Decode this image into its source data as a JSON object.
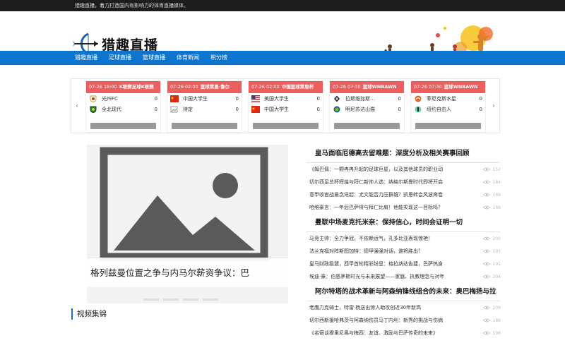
{
  "topbar": {
    "text": "猎趣直播，着力打造国内有影响力的体育直播媒体。"
  },
  "logo": {
    "text": "猎趣直播"
  },
  "nav": {
    "items": [
      "猎趣直播",
      "足球直播",
      "篮球直播",
      "体育新闻",
      "积分榜"
    ]
  },
  "matches": [
    {
      "time": "07-26 18:00",
      "league": "K联赛足球K联赛",
      "home": {
        "name": "光州FC",
        "score": "0",
        "icon": "club-crest-icon"
      },
      "away": {
        "name": "全北现代",
        "score": "0",
        "icon": "club-crest-icon"
      }
    },
    {
      "time": "07-26 02:00",
      "league": "篮球莱恩·鲁尔",
      "home": {
        "name": "中国大学生",
        "score": "0",
        "icon": "china-flag-icon"
      },
      "away": {
        "name": "待定",
        "score": "0",
        "icon": "broken-image-icon"
      }
    },
    {
      "time": "07-26 02:00",
      "league": "中国篮球莱恩杯",
      "home": {
        "name": "美国大学生",
        "score": "0",
        "icon": "usa-flag-icon"
      },
      "away": {
        "name": "中国大学生",
        "score": "0",
        "icon": "china-flag-icon"
      }
    },
    {
      "time": "07-26 07:30",
      "league": "篮球WNBAWN",
      "home": {
        "name": "拉斯维加斯…",
        "score": "0",
        "icon": "team-logo-icon"
      },
      "away": {
        "name": "明尼苏达山猫",
        "score": "0",
        "icon": "team-logo-icon"
      }
    },
    {
      "time": "07-26 07:30",
      "league": "篮球WNBAWN",
      "home": {
        "name": "菲尼克斯水星",
        "score": "0",
        "icon": "team-logo-icon"
      },
      "away": {
        "name": "纽约自由人",
        "score": "0",
        "icon": "team-logo-icon"
      }
    }
  ],
  "hero": {
    "caption": "格列兹曼位置之争与内马尔薪资争议：巴"
  },
  "video": {
    "title": "视频集锦"
  },
  "news": [
    {
      "headline": "皇马面临厄德高去留难题：深度分析及相关赛事回顾",
      "items": [
        {
          "text": "《姆巴佩：一颗冉冉升起的足球巨星，以及其他球员的职业动",
          "views": "152"
        },
        {
          "text": "切尔西足总杯辉煌与拜仁新帅人选：纳格尔斯曼时代即将开启",
          "views": "184"
        },
        {
          "text": "意甲收官战悬念迭起：尤文能否力压群雄？凯恩转会风波席卷",
          "views": "169"
        },
        {
          "text": "哈维豪言：一年后巴萨将与拜仁比肩！他能实现这一目标吗？",
          "views": "166"
        }
      ]
    },
    {
      "headline": "曼联中场麦克托米奈：保持信心，时间会证明一切",
      "items": [
        {
          "text": "马竞主帅：全力争冠，不依赖运气，孔多比亚表现惊艳！",
          "views": "200"
        },
        {
          "text": "法兰克福对阵斯图加特：德甲强强对话，谁将胜出？",
          "views": "193"
        },
        {
          "text": "皇马财政稳健，西甲首轮精彩纷呈：格拉纳达告捷，巴萨热身",
          "views": "191"
        },
        {
          "text": "埃迪·豪：伯恩茅斯时光与未来展望——家庭、执教理念与对年",
          "views": "204"
        }
      ]
    },
    {
      "headline": "阿尔特塔的战术革新与阿森纳锋线组合的未来：奥巴梅扬与拉",
      "items": [
        {
          "text": "老鹰力克骑士，特雷·杨送出惊人助攻创近30年新高",
          "views": "209"
        },
        {
          "text": "切尔西新援哈弗茨与阿森纳伤员马丁内利：新秀的挑战与伤病",
          "views": "188"
        },
        {
          "text": "《名宿谈穆里尼奥与梅西：友谊、激励与巴萨传奇的未来》",
          "views": "198"
        }
      ]
    }
  ]
}
